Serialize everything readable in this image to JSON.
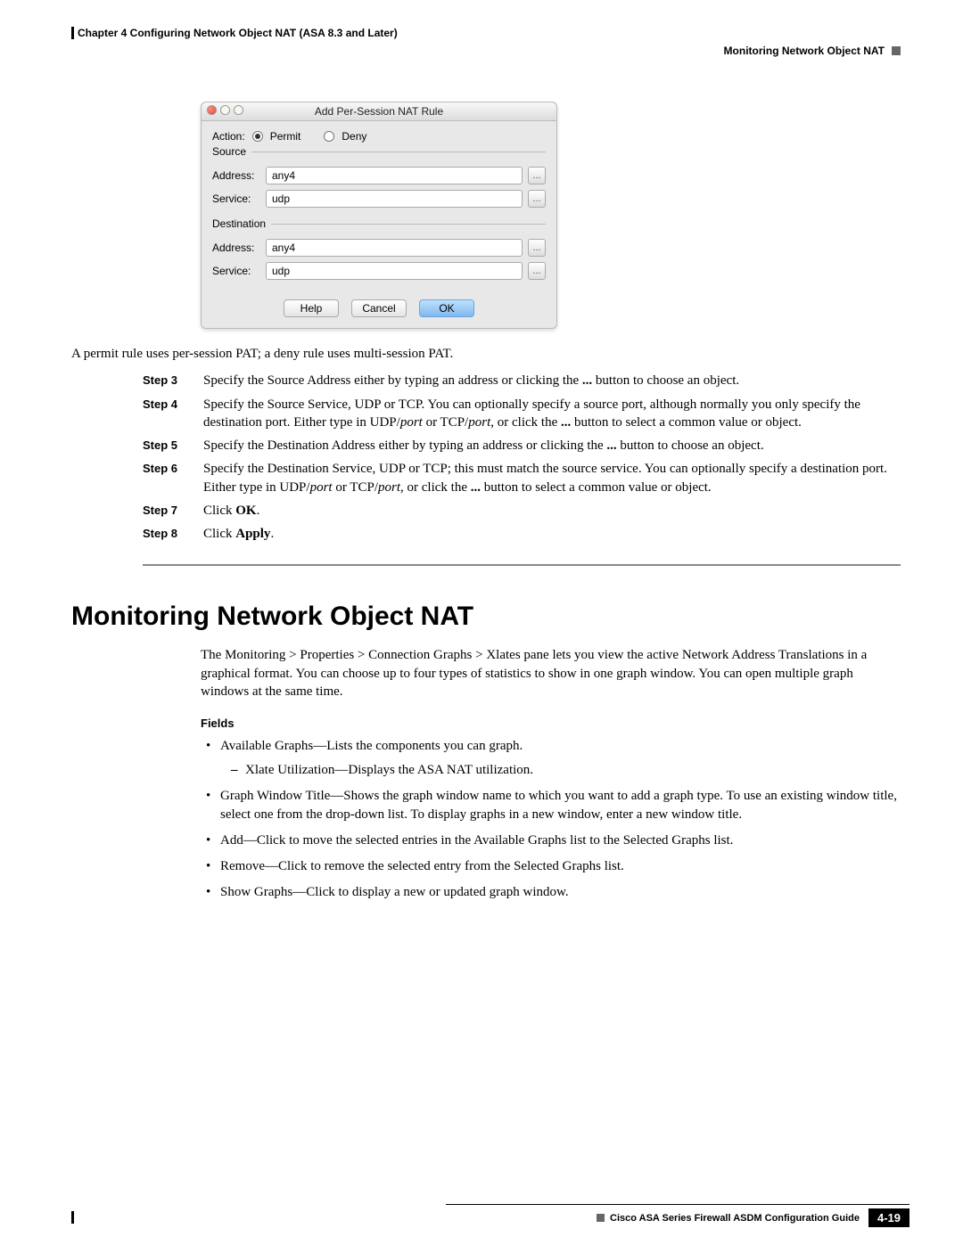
{
  "header": {
    "chapter": "Chapter 4      Configuring Network Object NAT (ASA 8.3 and Later)",
    "section": "Monitoring Network Object NAT"
  },
  "dialog": {
    "title": "Add Per-Session NAT Rule",
    "action_label": "Action:",
    "permit": "Permit",
    "deny": "Deny",
    "source_legend": "Source",
    "dest_legend": "Destination",
    "address_label": "Address:",
    "service_label": "Service:",
    "src_address": "any4",
    "src_service": "udp",
    "dst_address": "any4",
    "dst_service": "udp",
    "picker": "...",
    "help": "Help",
    "cancel": "Cancel",
    "ok": "OK"
  },
  "lead_para": "A permit rule uses per-session PAT; a deny rule uses multi-session PAT.",
  "steps": [
    {
      "label": "Step 3",
      "text_a": "Specify the Source Address either by typing an address or clicking the ",
      "bold_a": "...",
      "text_b": " button to choose an object."
    },
    {
      "label": "Step 4",
      "text_a": "Specify the Source Service, UDP or TCP. You can optionally specify a source port, although normally you only specify the destination port. Either type in UDP/",
      "italic_a": "port",
      "text_b": " or TCP/",
      "italic_b": "port",
      "text_c": ", or click the ",
      "bold_a": "...",
      "text_d": " button to select a common value or object."
    },
    {
      "label": "Step 5",
      "text_a": "Specify the Destination Address either by typing an address or clicking the ",
      "bold_a": "...",
      "text_b": " button to choose an object."
    },
    {
      "label": "Step 6",
      "text_a": "Specify the Destination Service, UDP or TCP; this must match the source service. You can optionally specify a destination port. Either type in UDP/",
      "italic_a": "port",
      "text_b": " or TCP/",
      "italic_b": "port",
      "text_c": ", or click the ",
      "bold_a": "...",
      "text_d": " button to select a common value or object."
    },
    {
      "label": "Step 7",
      "text_a": "Click ",
      "bold_a": "OK",
      "text_b": "."
    },
    {
      "label": "Step 8",
      "text_a": "Click ",
      "bold_a": "Apply",
      "text_b": "."
    }
  ],
  "section_title": "Monitoring Network Object NAT",
  "intro_para": "The Monitoring > Properties > Connection Graphs > Xlates pane lets you view the active Network Address Translations in a graphical format. You can choose up to four types of statistics to show in one graph window. You can open multiple graph windows at the same time.",
  "fields_heading": "Fields",
  "fields": {
    "b1": "Available Graphs—Lists the components you can graph.",
    "b1s1": "Xlate Utilization—Displays the ASA NAT utilization.",
    "b2": "Graph Window Title—Shows the graph window name to which you want to add a graph type. To use an existing window title, select one from the drop-down list. To display graphs in a new window, enter a new window title.",
    "b3": "Add—Click to move the selected entries in the Available Graphs list to the Selected Graphs list.",
    "b4": "Remove—Click to remove the selected entry from the Selected Graphs list.",
    "b5": "Show Graphs—Click to display a new or updated graph window."
  },
  "footer": {
    "guide": "Cisco ASA Series Firewall ASDM Configuration Guide",
    "page": "4-19"
  }
}
